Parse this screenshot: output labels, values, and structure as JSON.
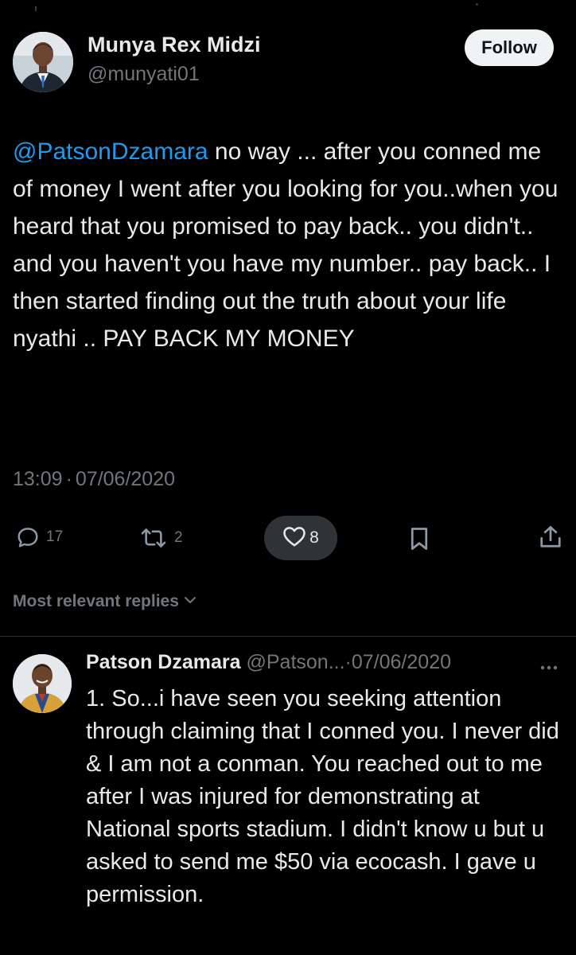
{
  "tweet": {
    "author": {
      "name": "Munya Rex Midzi",
      "handle": "@munyati01"
    },
    "follow_label": "Follow",
    "mention": "@PatsonDzamara",
    "body": " no way ... after you conned me of money I went after you looking for you..when you heard that you promised to pay back.. you didn't..  and you haven't you have my number.. pay back..  I then started finding out the truth about your life nyathi .. PAY BACK MY MONEY",
    "time": "13:09",
    "separator": "·",
    "date": "07/06/2020",
    "actions": {
      "reply_count": "17",
      "repost_count": "2",
      "like_count": "8"
    }
  },
  "replies_filter": {
    "label": "Most relevant replies"
  },
  "reply": {
    "name": "Patson Dzamara",
    "handle": "@Patson...",
    "separator": "·",
    "date": "07/06/2020",
    "text": "1. So...i have seen you seeking attention through claiming that I conned you. I never did & I am not a conman. You reached out to me after I was injured for demonstrating at National sports stadium. I didn't know u but u asked to send me $50 via ecocash. I gave u permission."
  },
  "icons": {
    "reply": "speech-bubble-icon",
    "repost": "repost-arrows-icon",
    "like": "heart-icon",
    "bookmark": "bookmark-icon",
    "share": "share-upload-icon",
    "chevron": "chevron-down-icon",
    "more": "more-dots-icon"
  },
  "colors": {
    "background": "#000000",
    "text": "#e7e9ea",
    "secondary": "#71767b",
    "link": "#1d9bf0",
    "follow_bg": "#eff3f4",
    "pill_bg": "#2f3336"
  }
}
